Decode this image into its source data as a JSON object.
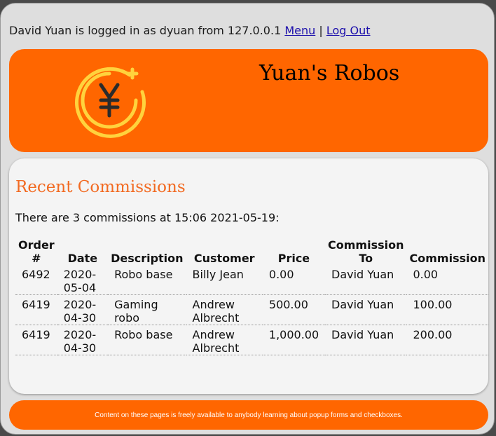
{
  "login": {
    "text": "David Yuan is logged in as dyuan from 127.0.0.1",
    "menu_link": "Menu",
    "separator": "|",
    "logout_link": "Log Out"
  },
  "header": {
    "title": "Yuan's Robos",
    "logo_icon": "yen-coin-icon",
    "logo_color": "#ffd33d"
  },
  "main": {
    "title": "Recent Commissions",
    "summary": "There are 3 commissions at 15:06 2021-05-19:",
    "columns": [
      "Order #",
      "Date",
      "Description",
      "Customer",
      "Price",
      "Commission To",
      "Commission"
    ],
    "rows": [
      {
        "order": "6492",
        "date": "2020-05-04",
        "description": "Robo base",
        "customer": "Billy Jean",
        "price": "0.00",
        "to": "David Yuan",
        "commission": "0.00"
      },
      {
        "order": "6419",
        "date": "2020-04-30",
        "description": "Gaming robo",
        "customer": "Andrew Albrecht",
        "price": "500.00",
        "to": "David Yuan",
        "commission": "100.00"
      },
      {
        "order": "6419",
        "date": "2020-04-30",
        "description": "Robo base",
        "customer": "Andrew Albrecht",
        "price": "1,000.00",
        "to": "David Yuan",
        "commission": "200.00"
      }
    ]
  },
  "footer": {
    "text": "Content on these pages is freely available to anybody learning about popup forms and checkboxes."
  },
  "colors": {
    "accent": "#ff6600",
    "title_orange": "#f26a21"
  }
}
